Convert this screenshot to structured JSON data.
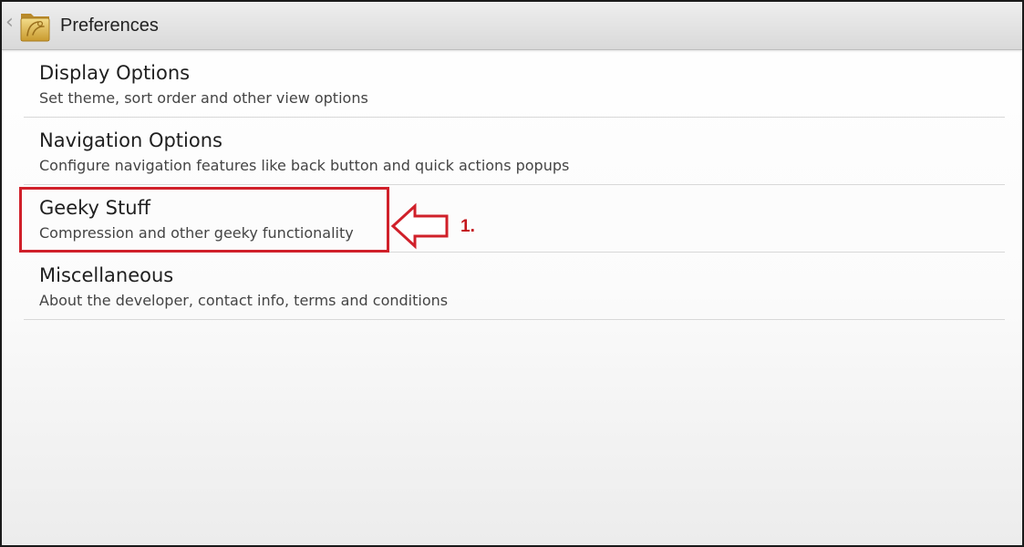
{
  "action_bar": {
    "title": "Preferences",
    "back_glyph": "‹",
    "up_icon": "chevron-left-icon",
    "app_icon": "folder-app-icon"
  },
  "preferences": {
    "items": [
      {
        "title": "Display Options",
        "summary": "Set theme, sort order and other view options"
      },
      {
        "title": "Navigation Options",
        "summary": "Configure navigation features like back button and quick actions popups"
      },
      {
        "title": "Geeky Stuff",
        "summary": "Compression and other geeky functionality"
      },
      {
        "title": "Miscellaneous",
        "summary": "About the developer, contact info, terms and conditions"
      }
    ]
  },
  "annotation": {
    "label": "1.",
    "color": "#d0202a",
    "highlighted_item": "Geeky Stuff"
  },
  "colors": {
    "action_bar": "#e4e4e4",
    "divider": "#d8d8d8",
    "title_text": "#1f1f1f",
    "summary_text": "#444444"
  }
}
